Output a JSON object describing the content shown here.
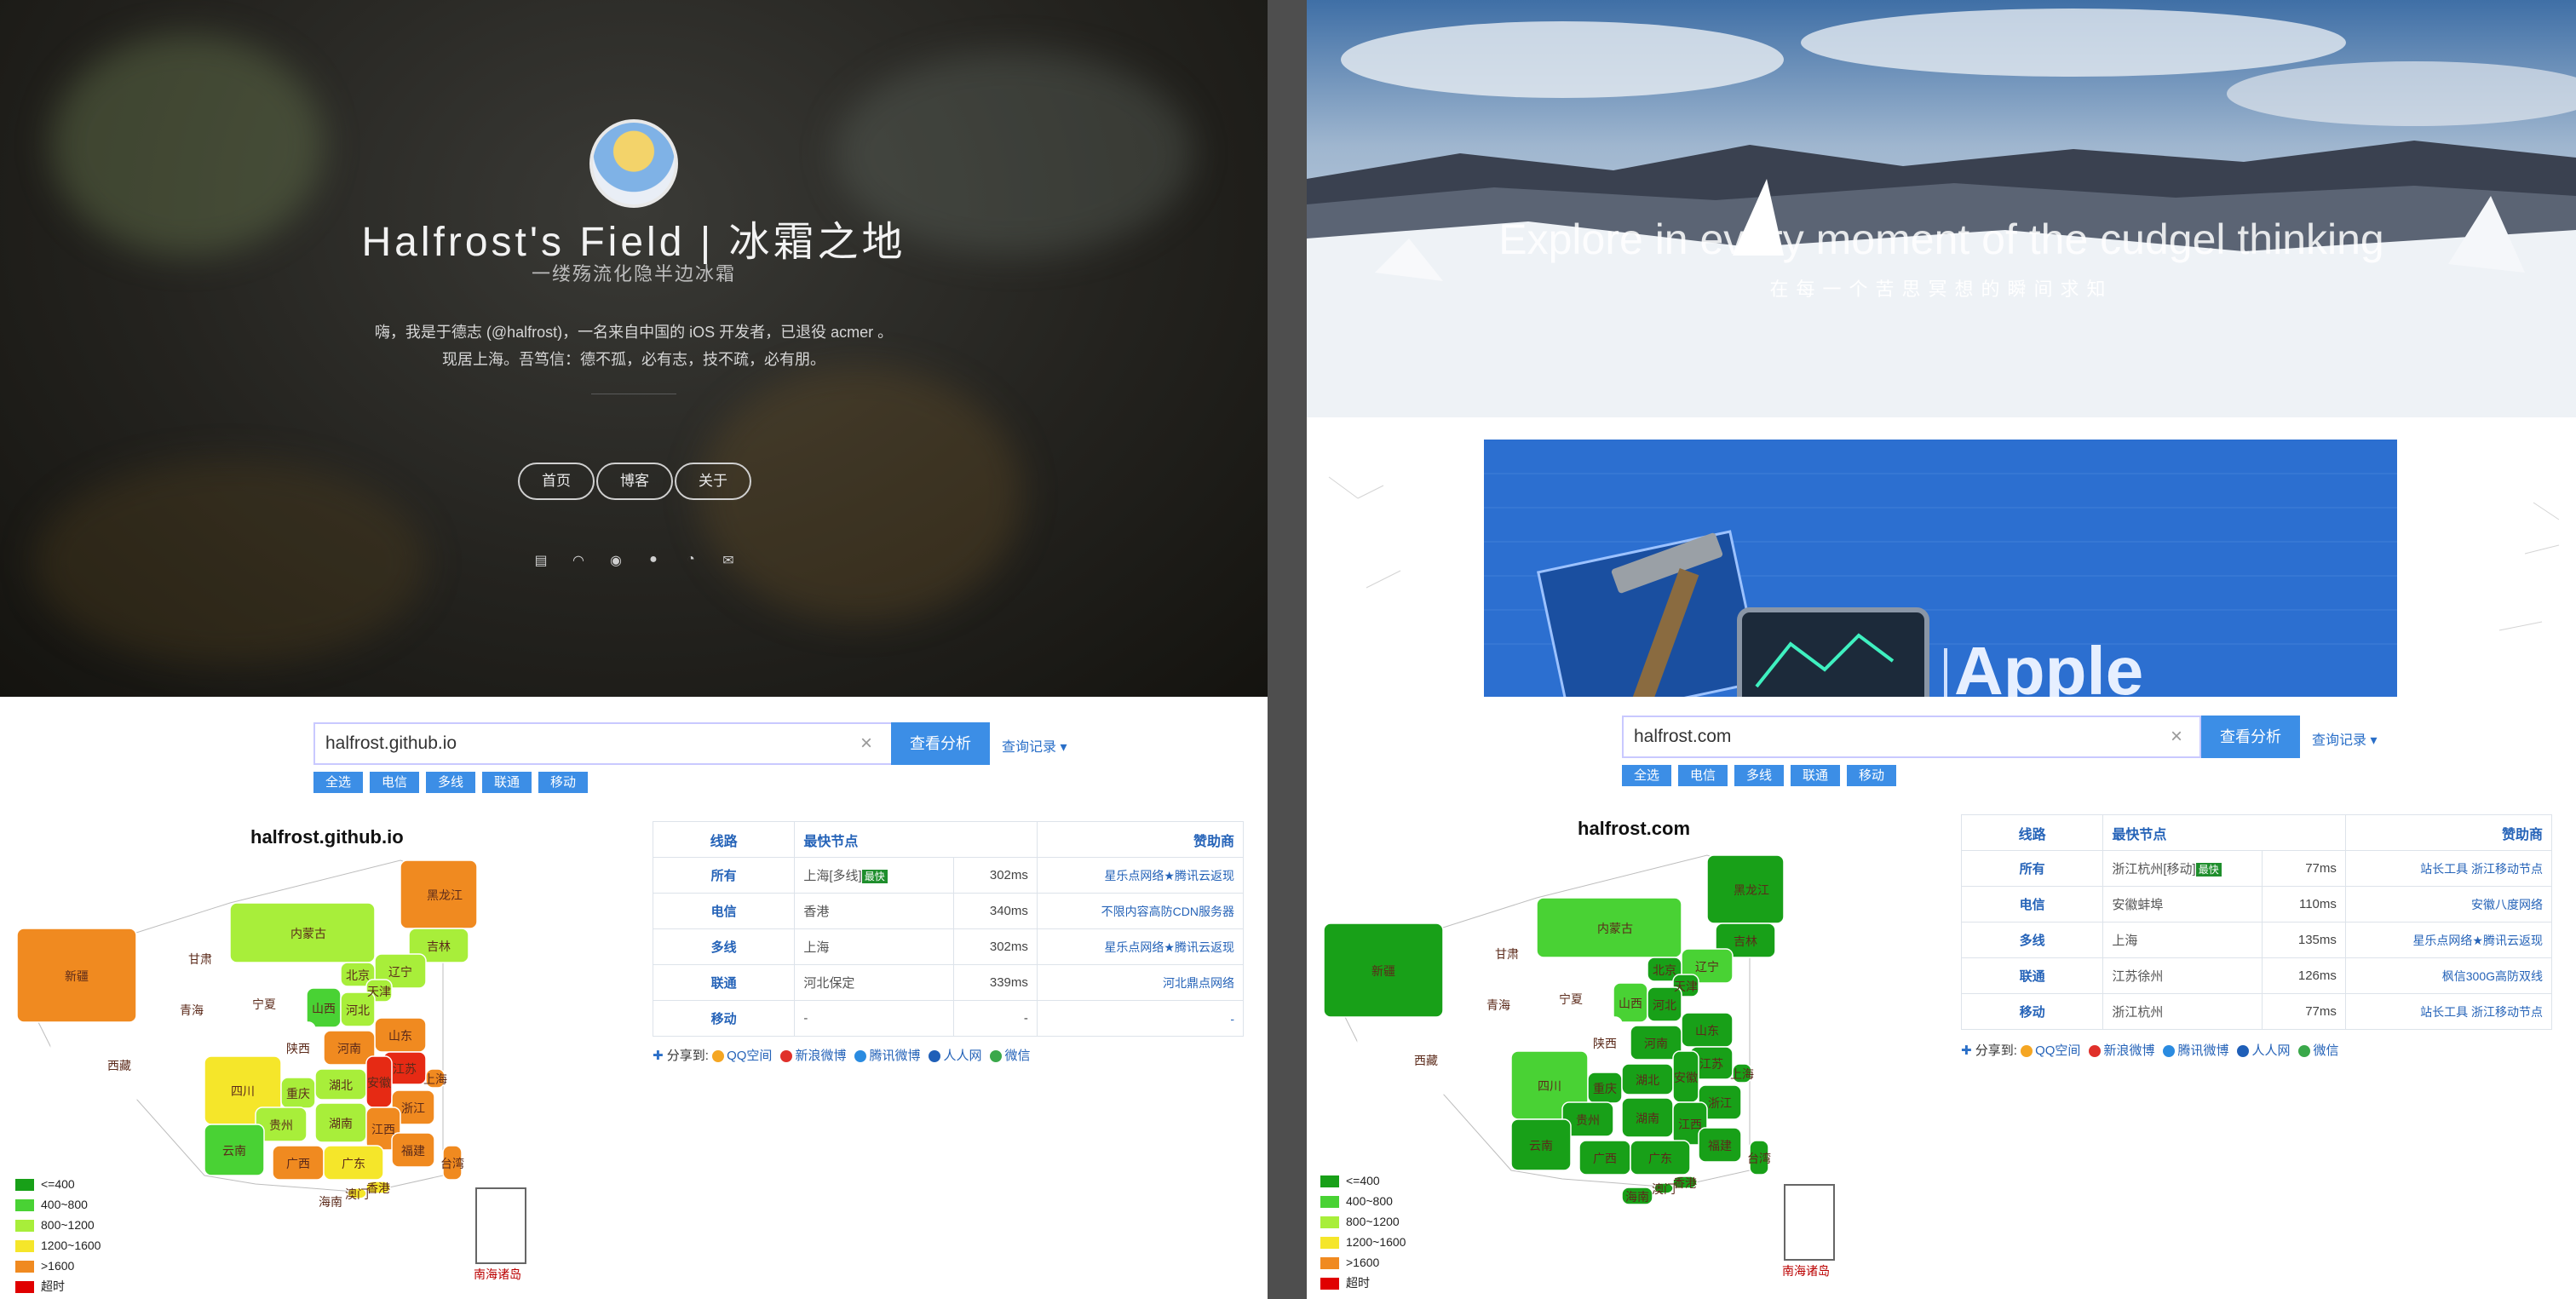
{
  "blog": {
    "title": "Halfrost's Field | 冰霜之地",
    "subtitle": "一缕殇流化隐半边冰霜",
    "intro_line1": "嗨，我是于德志 (@halfrost)，一名来自中国的 iOS 开发者，已退役 acmer 。",
    "intro_line2": "现居上海。吾笃信：德不孤，必有志，技不疏，必有朋。",
    "nav": [
      "首页",
      "博客",
      "关于"
    ],
    "social_icons": [
      "book-icon",
      "feed-icon",
      "weibo-icon",
      "github-icon",
      "rss-icon",
      "mail-icon"
    ]
  },
  "site": {
    "hero_title": "Explore in every moment of the cudgel thinking",
    "hero_subtitle": "在每一个苦思冥想的瞬间求知",
    "banner_text": "Apple"
  },
  "tests": [
    {
      "query": "halfrost.github.io",
      "search_button": "查看分析",
      "history": "查询记录",
      "chips": [
        "全选",
        "电信",
        "多线",
        "联通",
        "移动"
      ],
      "map_title": "halfrost.github.io",
      "headers": {
        "line": "线路",
        "node": "最快节点",
        "sponsor": "赞助商"
      },
      "rows": [
        {
          "line": "所有",
          "node": "上海[多线]",
          "badge": "最快",
          "ms": "302ms",
          "sponsor": "星乐点网络★腾讯云返现"
        },
        {
          "line": "电信",
          "node": "香港",
          "badge": "",
          "ms": "340ms",
          "sponsor": "不限内容高防CDN服务器"
        },
        {
          "line": "多线",
          "node": "上海",
          "badge": "",
          "ms": "302ms",
          "sponsor": "星乐点网络★腾讯云返现"
        },
        {
          "line": "联通",
          "node": "河北保定",
          "badge": "",
          "ms": "339ms",
          "sponsor": "河北鼎点网络"
        },
        {
          "line": "移动",
          "node": "-",
          "badge": "",
          "ms": "-",
          "sponsor": "-"
        }
      ],
      "provinces": [
        {
          "name": "新疆",
          "color": "#f08a20"
        },
        {
          "name": "西藏",
          "color": "#ffffff"
        },
        {
          "name": "青海",
          "color": "#ffffff"
        },
        {
          "name": "甘肃",
          "color": "#ffffff"
        },
        {
          "name": "内蒙古",
          "color": "#a8ee3a"
        },
        {
          "name": "黑龙江",
          "color": "#f08a20"
        },
        {
          "name": "吉林",
          "color": "#a8ee3a"
        },
        {
          "name": "辽宁",
          "color": "#a8ee3a"
        },
        {
          "name": "北京",
          "color": "#a8ee3a"
        },
        {
          "name": "天津",
          "color": "#a8ee3a"
        },
        {
          "name": "宁夏",
          "color": "#ffffff"
        },
        {
          "name": "山西",
          "color": "#49d234"
        },
        {
          "name": "河北",
          "color": "#a8ee3a"
        },
        {
          "name": "山东",
          "color": "#f08a20"
        },
        {
          "name": "陕西",
          "color": "#ffffff"
        },
        {
          "name": "河南",
          "color": "#f08a20"
        },
        {
          "name": "江苏",
          "color": "#e62a14"
        },
        {
          "name": "上海",
          "color": "#f08a20"
        },
        {
          "name": "四川",
          "color": "#f5e62a"
        },
        {
          "name": "重庆",
          "color": "#a8ee3a"
        },
        {
          "name": "湖北",
          "color": "#a8ee3a"
        },
        {
          "name": "安徽",
          "color": "#e62a14"
        },
        {
          "name": "浙江",
          "color": "#f08a20"
        },
        {
          "name": "贵州",
          "color": "#a8ee3a"
        },
        {
          "name": "湖南",
          "color": "#a8ee3a"
        },
        {
          "name": "江西",
          "color": "#f08a20"
        },
        {
          "name": "福建",
          "color": "#f08a20"
        },
        {
          "name": "云南",
          "color": "#49d234"
        },
        {
          "name": "广西",
          "color": "#f08a20"
        },
        {
          "name": "广东",
          "color": "#f5e62a"
        },
        {
          "name": "台湾",
          "color": "#f08a20"
        },
        {
          "name": "香港",
          "color": "#f5e62a"
        },
        {
          "name": "澳门",
          "color": "#f5e62a"
        },
        {
          "name": "海南",
          "color": "#ffffff"
        }
      ],
      "sea": "南海诸岛",
      "share": {
        "label": "分享到:",
        "items": [
          "QQ空间",
          "新浪微博",
          "腾讯微博",
          "人人网",
          "微信"
        ]
      }
    },
    {
      "query": "halfrost.com",
      "search_button": "查看分析",
      "history": "查询记录",
      "chips": [
        "全选",
        "电信",
        "多线",
        "联通",
        "移动"
      ],
      "map_title": "halfrost.com",
      "headers": {
        "line": "线路",
        "node": "最快节点",
        "sponsor": "赞助商"
      },
      "rows": [
        {
          "line": "所有",
          "node": "浙江杭州[移动]",
          "badge": "最快",
          "ms": "77ms",
          "sponsor": "站长工具 浙江移动节点"
        },
        {
          "line": "电信",
          "node": "安徽蚌埠",
          "badge": "",
          "ms": "110ms",
          "sponsor": "安徽八度网络"
        },
        {
          "line": "多线",
          "node": "上海",
          "badge": "",
          "ms": "135ms",
          "sponsor": "星乐点网络★腾讯云返现"
        },
        {
          "line": "联通",
          "node": "江苏徐州",
          "badge": "",
          "ms": "126ms",
          "sponsor": "枫信300G高防双线"
        },
        {
          "line": "移动",
          "node": "浙江杭州",
          "badge": "",
          "ms": "77ms",
          "sponsor": "站长工具 浙江移动节点"
        }
      ],
      "provinces": [
        {
          "name": "新疆",
          "color": "#18a018"
        },
        {
          "name": "西藏",
          "color": "#ffffff"
        },
        {
          "name": "青海",
          "color": "#ffffff"
        },
        {
          "name": "甘肃",
          "color": "#ffffff"
        },
        {
          "name": "内蒙古",
          "color": "#49d234"
        },
        {
          "name": "黑龙江",
          "color": "#18a018"
        },
        {
          "name": "吉林",
          "color": "#18a018"
        },
        {
          "name": "辽宁",
          "color": "#49d234"
        },
        {
          "name": "北京",
          "color": "#18a018"
        },
        {
          "name": "天津",
          "color": "#18a018"
        },
        {
          "name": "宁夏",
          "color": "#ffffff"
        },
        {
          "name": "山西",
          "color": "#49d234"
        },
        {
          "name": "河北",
          "color": "#18a018"
        },
        {
          "name": "山东",
          "color": "#18a018"
        },
        {
          "name": "陕西",
          "color": "#ffffff"
        },
        {
          "name": "河南",
          "color": "#18a018"
        },
        {
          "name": "江苏",
          "color": "#18a018"
        },
        {
          "name": "上海",
          "color": "#18a018"
        },
        {
          "name": "四川",
          "color": "#49d234"
        },
        {
          "name": "重庆",
          "color": "#18a018"
        },
        {
          "name": "湖北",
          "color": "#18a018"
        },
        {
          "name": "安徽",
          "color": "#18a018"
        },
        {
          "name": "浙江",
          "color": "#18a018"
        },
        {
          "name": "贵州",
          "color": "#18a018"
        },
        {
          "name": "湖南",
          "color": "#18a018"
        },
        {
          "name": "江西",
          "color": "#18a018"
        },
        {
          "name": "福建",
          "color": "#18a018"
        },
        {
          "name": "云南",
          "color": "#18a018"
        },
        {
          "name": "广西",
          "color": "#18a018"
        },
        {
          "name": "广东",
          "color": "#18a018"
        },
        {
          "name": "台湾",
          "color": "#18a018"
        },
        {
          "name": "香港",
          "color": "#18a018"
        },
        {
          "name": "澳门",
          "color": "#18a018"
        },
        {
          "name": "海南",
          "color": "#18a018"
        }
      ],
      "sea": "南海诸岛",
      "share": {
        "label": "分享到:",
        "items": [
          "QQ空间",
          "新浪微博",
          "腾讯微博",
          "人人网",
          "微信"
        ]
      }
    }
  ],
  "legend": [
    {
      "label": "<=400",
      "color": "#18a018"
    },
    {
      "label": "400~800",
      "color": "#49d234"
    },
    {
      "label": "800~1200",
      "color": "#a8ee3a"
    },
    {
      "label": "1200~1600",
      "color": "#f5e62a"
    },
    {
      "label": ">1600",
      "color": "#f08a20"
    },
    {
      "label": "超时",
      "color": "#e00000"
    }
  ]
}
